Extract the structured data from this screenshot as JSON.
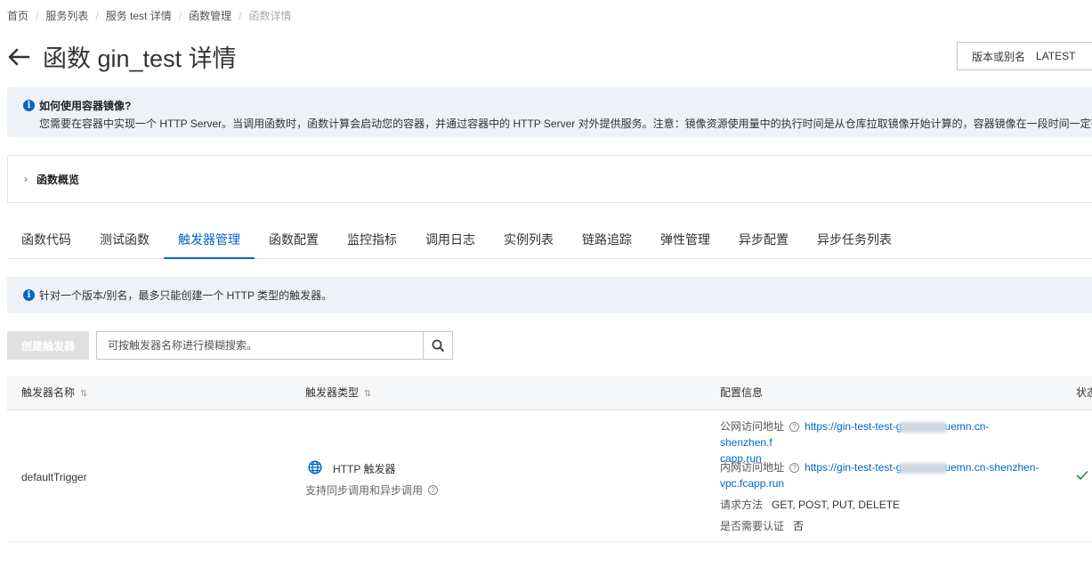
{
  "breadcrumb": [
    "首页",
    "服务列表",
    "服务 test 详情",
    "函数管理",
    "函数详情"
  ],
  "page_title": "函数 gin_test 详情",
  "version": {
    "label": "版本或别名",
    "value": "LATEST"
  },
  "notice_main": {
    "title": "如何使用容器镜像?",
    "body": "您需要在容器中实现一个 HTTP Server。当调用函数时，函数计算会启动您的容器，并通过容器中的 HTTP Server 对外提供服务。注意：镜像资源使用量中的执行时间是从仓库拉取镜像开始计算的，容器镜像在一段时间一定范"
  },
  "overview_label": "函数概览",
  "tabs": [
    "函数代码",
    "测试函数",
    "触发器管理",
    "函数配置",
    "监控指标",
    "调用日志",
    "实例列表",
    "链路追踪",
    "弹性管理",
    "异步配置",
    "异步任务列表"
  ],
  "active_tab": "触发器管理",
  "notice_http": "针对一个版本/别名，最多只能创建一个 HTTP 类型的触发器。",
  "create_button": "创建触发器",
  "search_placeholder": "可按触发器名称进行模糊搜索。",
  "table": {
    "headers": {
      "name": "触发器名称",
      "type": "触发器类型",
      "config": "配置信息",
      "status": "状态"
    },
    "rows": [
      {
        "name": "defaultTrigger",
        "type": "HTTP 触发器",
        "type_desc": "支持同步调用和异步调用",
        "public_label": "公网访问地址",
        "public_url_a": "https://gin-test-test-g",
        "public_url_b": "uemn.cn-shenzhen.f",
        "public_url_c": "capp.run",
        "internal_label": "内网访问地址",
        "internal_url_a": "https://gin-test-test-g",
        "internal_url_b": "uemn.cn-shenzhen-",
        "internal_url_c": "vpc.fcapp.run",
        "method_label": "请求方法",
        "methods": "GET, POST, PUT, DELETE",
        "auth_label": "是否需要认证",
        "auth_value": "否",
        "status_icon": "check-icon"
      }
    ]
  },
  "colors": {
    "accent": "#0064c8",
    "notice_bg": "#eef1f5",
    "success": "#1e8e3e"
  }
}
